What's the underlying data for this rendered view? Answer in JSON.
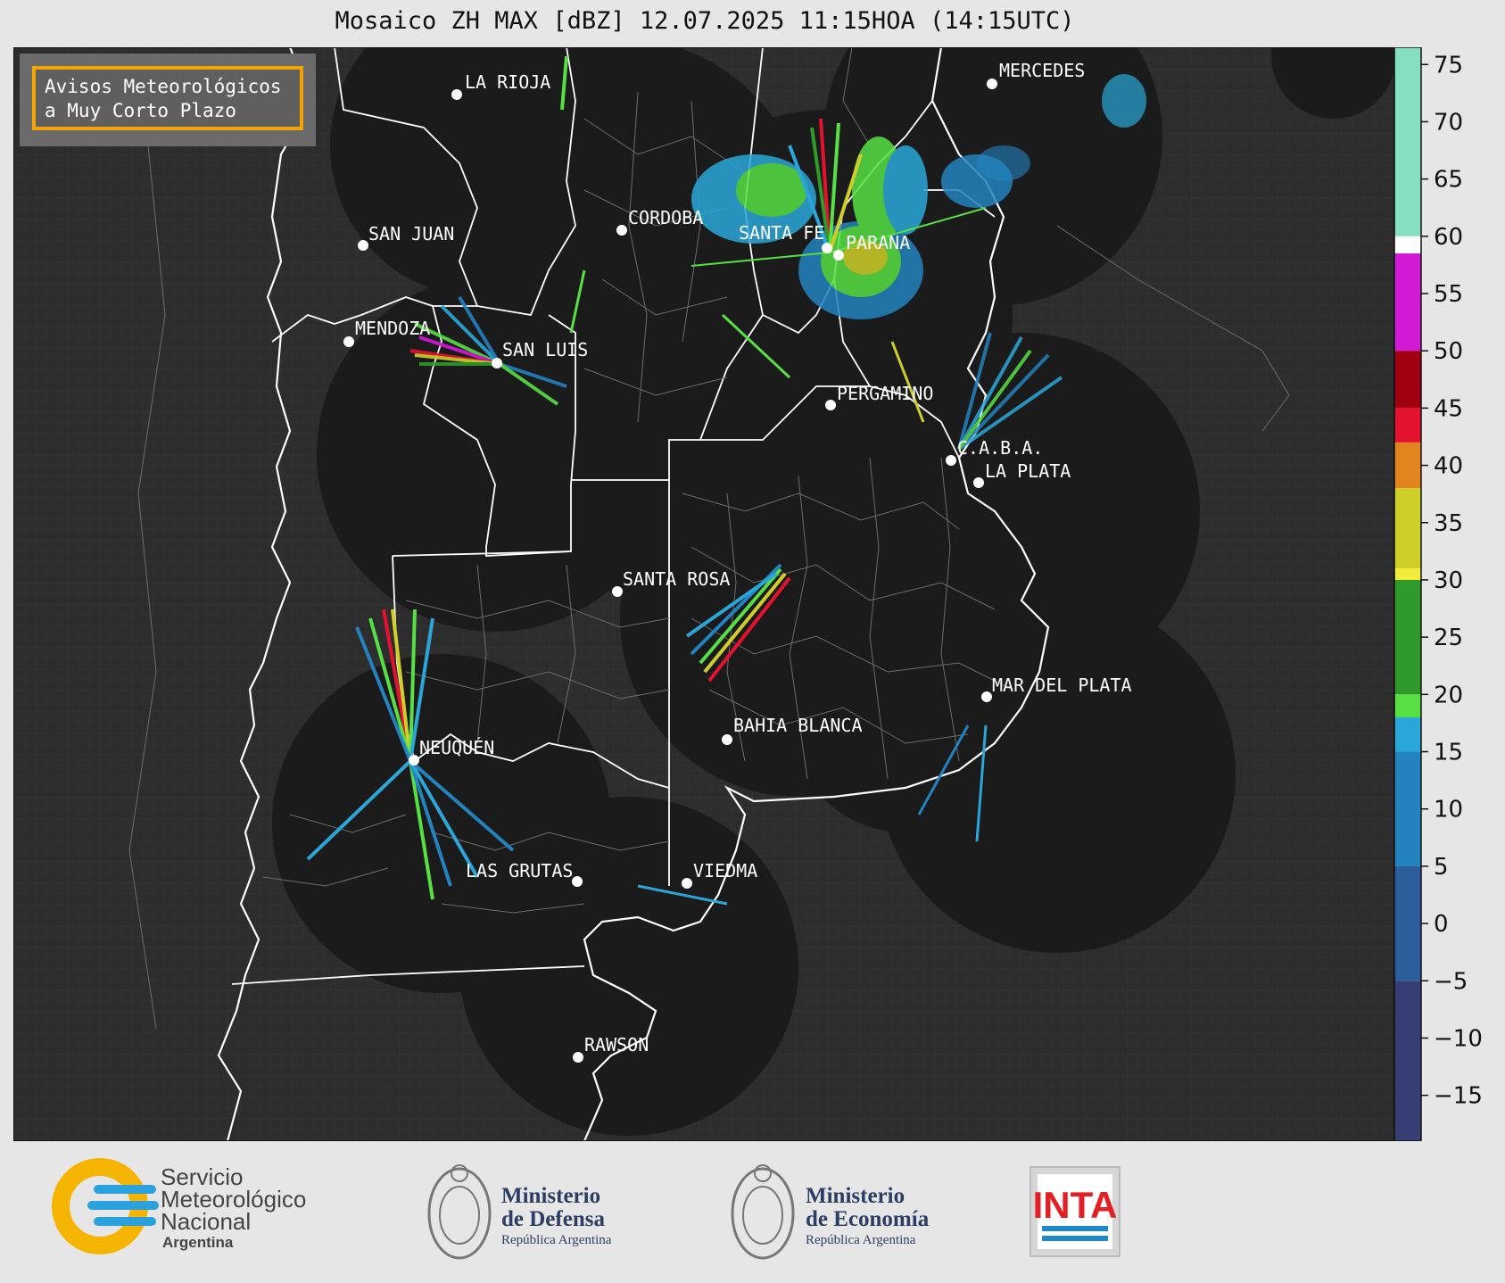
{
  "title": "Mosaico ZH MAX [dBZ] 12.07.2025 11:15HOA (14:15UTC)",
  "legend": {
    "line1": "Avisos Meteorológicos",
    "line2": "a Muy Corto Plazo"
  },
  "cities": [
    {
      "id": "la-rioja",
      "name": "LA RIOJA"
    },
    {
      "id": "mercedes",
      "name": "MERCEDES"
    },
    {
      "id": "san-juan",
      "name": "SAN JUAN"
    },
    {
      "id": "cordoba",
      "name": "CORDOBA"
    },
    {
      "id": "santa-fe",
      "name": "SANTA FE"
    },
    {
      "id": "parana",
      "name": "PARANA"
    },
    {
      "id": "mendoza",
      "name": "MENDOZA"
    },
    {
      "id": "san-luis",
      "name": "SAN LUIS"
    },
    {
      "id": "pergamino",
      "name": "PERGAMINO"
    },
    {
      "id": "caba",
      "name": "C.A.B.A."
    },
    {
      "id": "la-plata",
      "name": "LA PLATA"
    },
    {
      "id": "santa-rosa",
      "name": "SANTA ROSA"
    },
    {
      "id": "mar-del-plata",
      "name": "MAR DEL PLATA"
    },
    {
      "id": "bahia-blanca",
      "name": "BAHIA BLANCA"
    },
    {
      "id": "neuquen",
      "name": "NEUQUÉN"
    },
    {
      "id": "las-grutas",
      "name": "LAS GRUTAS"
    },
    {
      "id": "viedma",
      "name": "VIEDMA"
    },
    {
      "id": "rawson",
      "name": "RAWSON"
    }
  ],
  "colorbar": {
    "unit": "dBZ",
    "min": -19,
    "max": 76.5,
    "ticks": [
      "75",
      "70",
      "65",
      "60",
      "55",
      "50",
      "45",
      "40",
      "35",
      "30",
      "25",
      "20",
      "15",
      "10",
      "5",
      "0",
      "−5",
      "−10",
      "−15"
    ],
    "tick_values": [
      75,
      70,
      65,
      60,
      55,
      50,
      45,
      40,
      35,
      30,
      25,
      20,
      15,
      10,
      5,
      0,
      -5,
      -10,
      -15
    ],
    "bands": [
      {
        "from": 60,
        "to": 76.5,
        "color": "#86dfc0"
      },
      {
        "from": 58.5,
        "to": 60,
        "color": "#ffffff"
      },
      {
        "from": 50,
        "to": 58.5,
        "color": "#d11ad6"
      },
      {
        "from": 45,
        "to": 50,
        "color": "#a10010"
      },
      {
        "from": 42,
        "to": 45,
        "color": "#e3132f"
      },
      {
        "from": 38,
        "to": 42,
        "color": "#e3851e"
      },
      {
        "from": 31,
        "to": 38,
        "color": "#cfcf2a"
      },
      {
        "from": 30,
        "to": 31,
        "color": "#f2ec3a"
      },
      {
        "from": 20,
        "to": 30,
        "color": "#2f9a2a"
      },
      {
        "from": 18,
        "to": 20,
        "color": "#56e044"
      },
      {
        "from": 15,
        "to": 18,
        "color": "#2aa7d8"
      },
      {
        "from": 5,
        "to": 15,
        "color": "#2383bf"
      },
      {
        "from": -5,
        "to": 5,
        "color": "#2c5e9c"
      },
      {
        "from": -19,
        "to": -5,
        "color": "#363f73"
      }
    ]
  },
  "footer": {
    "smn_line1": "Servicio",
    "smn_line2": "Meteorológico",
    "smn_line3": "Nacional",
    "smn_line4": "Argentina",
    "defensa_line1": "Ministerio",
    "defensa_line2": "de Defensa",
    "defensa_line3": "República Argentina",
    "economia_line1": "Ministerio",
    "economia_line2": "de Economía",
    "economia_line3": "República Argentina",
    "inta": "INTA"
  }
}
